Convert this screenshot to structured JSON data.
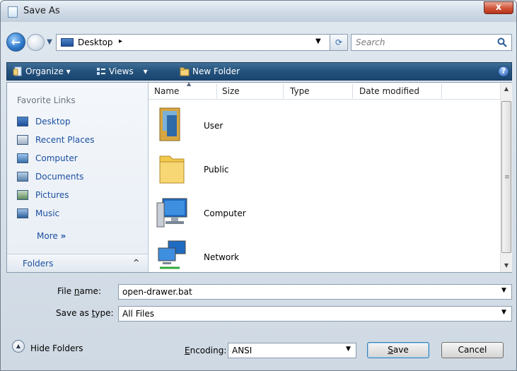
{
  "window": {
    "title": "Save As",
    "close_label": "x"
  },
  "nav": {
    "back_glyph": "←",
    "address": "Desktop",
    "address_chevron": "▸",
    "address_dropdown": "▼",
    "search_placeholder": "Search"
  },
  "toolbar": {
    "organize": "Organize",
    "views": "Views",
    "new_folder": "New Folder",
    "dropdown_glyph": "▾",
    "help_glyph": "?"
  },
  "favorites": {
    "title": "Favorite Links",
    "items": [
      {
        "label": "Desktop",
        "icon": "desktop-icon"
      },
      {
        "label": "Recent Places",
        "icon": "recent-places-icon"
      },
      {
        "label": "Computer",
        "icon": "computer-icon"
      },
      {
        "label": "Documents",
        "icon": "documents-icon"
      },
      {
        "label": "Pictures",
        "icon": "pictures-icon"
      },
      {
        "label": "Music",
        "icon": "music-icon"
      }
    ],
    "more": "More",
    "more_glyph": "»",
    "folders": "Folders",
    "folders_chevron": "^"
  },
  "columns": [
    "Name",
    "Size",
    "Type",
    "Date modified"
  ],
  "files": [
    {
      "name": "User",
      "icon": "user-folder-icon"
    },
    {
      "name": "Public",
      "icon": "folder-icon"
    },
    {
      "name": "Computer",
      "icon": "computer-icon"
    },
    {
      "name": "Network",
      "icon": "network-icon"
    }
  ],
  "form": {
    "file_name_label_pre": "File ",
    "file_name_label_u": "n",
    "file_name_label_post": "ame:",
    "file_name_value": "open-drawer.bat",
    "type_label_pre": "Save as ",
    "type_label_u": "t",
    "type_label_post": "ype:",
    "type_value": "All Files",
    "hide_folders": "Hide Folders",
    "encoding_label_u": "E",
    "encoding_label_post": "ncoding:",
    "encoding_value": "ANSI",
    "save_u": "S",
    "save_post": "ave",
    "cancel": "Cancel"
  },
  "colors": {
    "accent": "#1b4fa0",
    "toolbar": "#23527c",
    "close": "#c9452a"
  }
}
